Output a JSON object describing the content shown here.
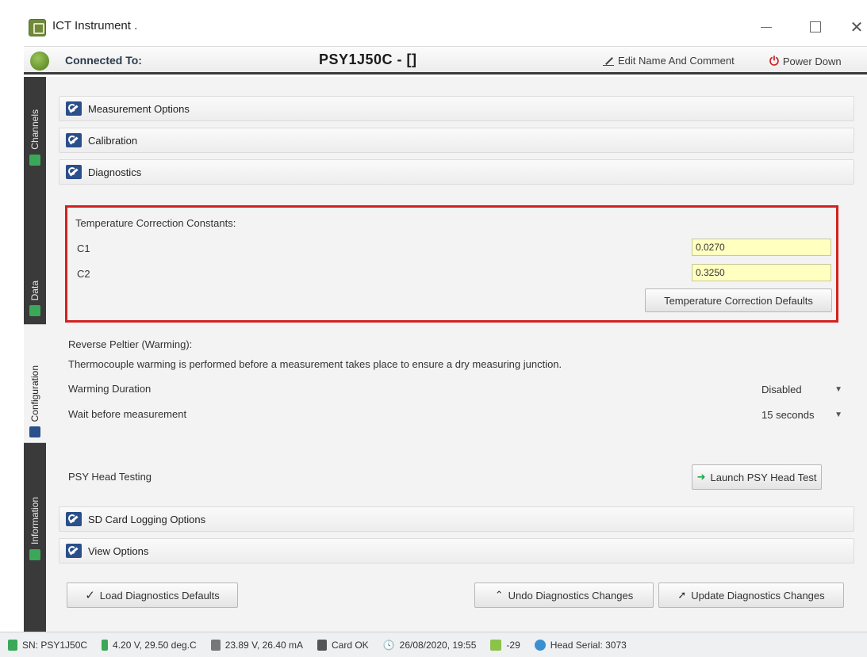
{
  "window": {
    "title": "ICT Instrument .",
    "minimize_glyph": "—",
    "close_glyph": "✕"
  },
  "toolbar": {
    "connected_label": "Connected To:",
    "device_name": "PSY1J50C - []",
    "edit_label": "Edit Name And Comment",
    "power_label": "Power Down",
    "power_glyph": "⏻"
  },
  "sidebar": {
    "tabs": [
      {
        "label": "Channels",
        "icon": "channels-icon",
        "color": "#3aa858"
      },
      {
        "label": "Data",
        "icon": "data-icon",
        "color": "#3aa858"
      },
      {
        "label": "Configuration",
        "icon": "configuration-icon",
        "color": "#2a4f8a"
      },
      {
        "label": "Information",
        "icon": "information-icon",
        "color": "#3aa858"
      }
    ]
  },
  "sections": {
    "measurement": "Measurement Options",
    "calibration": "Calibration",
    "diagnostics": "Diagnostics",
    "sd_card": "SD Card Logging Options",
    "view": "View Options"
  },
  "diagnostics": {
    "temp_title": "Temperature Correction Constants:",
    "c1_label": "C1",
    "c1_value": "0.0270",
    "c2_label": "C2",
    "c2_value": "0.3250",
    "temp_defaults_button": "Temperature Correction Defaults",
    "reverse_title": "Reverse Peltier (Warming):",
    "reverse_desc": "Thermocouple warming is performed before a measurement takes place to ensure a dry measuring junction.",
    "warming_label": "Warming Duration",
    "warming_value": "Disabled",
    "wait_label": "Wait before measurement",
    "wait_value": "15 seconds",
    "head_testing_label": "PSY Head Testing",
    "launch_button": "Launch PSY Head Test"
  },
  "footer_buttons": {
    "load_defaults": "Load Diagnostics Defaults",
    "undo": "Undo Diagnostics Changes",
    "update": "Update Diagnostics Changes"
  },
  "statusbar": {
    "sn": "SN: PSY1J50C",
    "battery": "4.20 V, 29.50 deg.C",
    "power": "23.89 V, 26.40 mA",
    "card": "Card OK",
    "datetime": "26/08/2020, 19:55",
    "signal": "-29",
    "head_serial": "Head Serial: 3073"
  },
  "colors": {
    "accent_red": "#d42020",
    "input_yellow": "#ffffc0",
    "icon_blue": "#2a4f8a",
    "icon_green": "#3aa858"
  }
}
